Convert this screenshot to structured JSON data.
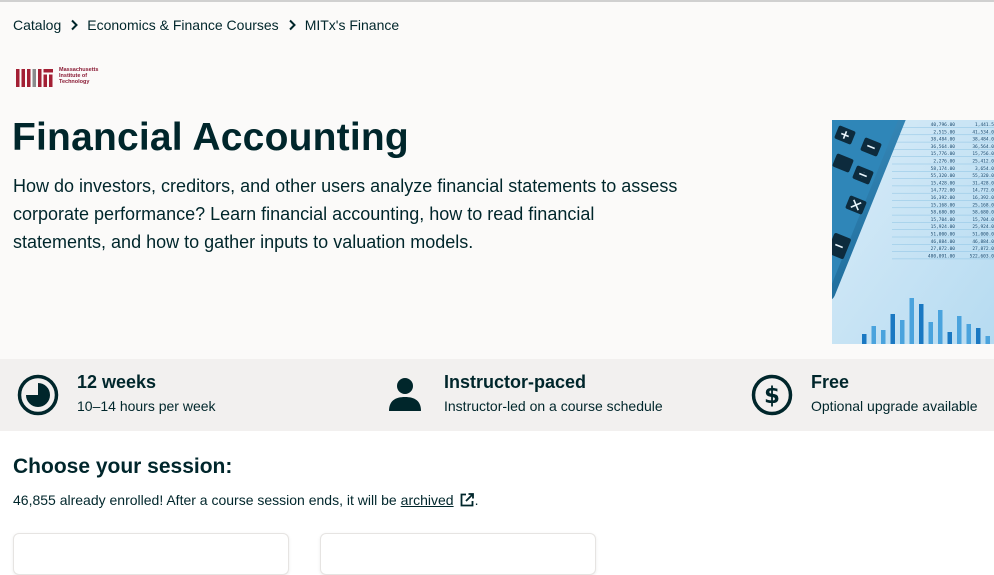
{
  "breadcrumb": {
    "items": [
      "Catalog",
      "Economics & Finance Courses",
      "MITx's Finance"
    ]
  },
  "logo": {
    "lines": [
      "Massachusetts",
      "Institute of",
      "Technology"
    ]
  },
  "course": {
    "title": "Financial Accounting",
    "description": "How do investors, creditors, and other users analyze financial statements to assess corporate performance? Learn financial accounting, how to read financial statements, and how to gather inputs to valuation models."
  },
  "hero_image": {
    "icon": "calculator-spreadsheet-image",
    "rows": [
      "40,796.00",
      "2,515.00",
      "38,484.00",
      "36,564.00",
      "15,776.00",
      "2,276.00",
      "58,174.00",
      "55,320.00",
      "15,428.00",
      "14,772.00",
      "16,392.00",
      "15,168.00",
      "58,680.00",
      "15,704.00",
      "15,924.00",
      "51,000.00",
      "46,884.00",
      "27,872.00",
      "480,091.00"
    ],
    "rows2": [
      "1,441.5",
      "41,534.0",
      "38,484.0",
      "36,564.0",
      "15,756.0",
      "25,412.0",
      "3,654.0",
      "55,320.0",
      "31,428.0",
      "14,772.0",
      "16,392.0",
      "25,168.0",
      "58,680.0",
      "15,704.0",
      "25,924.0",
      "51,000.0",
      "46,884.0",
      "27,872.0",
      "522,603.0"
    ]
  },
  "facts": [
    {
      "icon": "clock-icon",
      "title": "12 weeks",
      "subtitle": "10–14 hours per week"
    },
    {
      "icon": "person-icon",
      "title": "Instructor-paced",
      "subtitle": "Instructor-led on a course schedule"
    },
    {
      "icon": "dollar-circle-icon",
      "title": "Free",
      "subtitle": "Optional upgrade available"
    }
  ],
  "session": {
    "heading": "Choose your session:",
    "enrolled_text": "46,855 already enrolled! After a course session ends, it will be",
    "archived_label": "archived",
    "period": "."
  },
  "colors": {
    "text": "#00262b",
    "hero_bg": "#fbfaf9",
    "facts_bg": "#f2f0ef",
    "mit_red": "#a31f34",
    "mit_gray": "#8a8b8c"
  }
}
